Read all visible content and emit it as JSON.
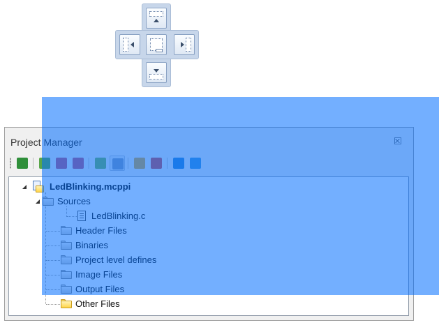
{
  "panel": {
    "title": "Project Manager"
  },
  "toolbar": {
    "buttons": [
      {
        "icon": "open-project-icon",
        "color": "#2f8f3a"
      },
      {
        "icon": "build-project-icon",
        "color": "#5aa64a"
      },
      {
        "icon": "build-all-icon",
        "color": "#c0597a"
      },
      {
        "icon": "build-debug-icon",
        "color": "#c0597a"
      },
      {
        "icon": "add-file-icon",
        "color": "#7ab65a"
      },
      {
        "icon": "remove-file-icon",
        "color": "#8d9db8"
      },
      {
        "icon": "add-folder-icon",
        "color": "#e0a83a"
      },
      {
        "icon": "remove-folder-icon",
        "color": "#d05050"
      },
      {
        "icon": "edit-project-icon",
        "color": "#3a8ad0"
      },
      {
        "icon": "clean-project-icon",
        "color": "#4a9ad8"
      }
    ]
  },
  "tree": {
    "root": "LedBlinking.mcppi",
    "sources": "Sources",
    "source_file": "LedBlinking.c",
    "folders": [
      "Header Files",
      "Binaries",
      "Project level defines",
      "Image Files",
      "Output Files",
      "Other Files"
    ]
  },
  "colors": {
    "dock_preview": "#006eff",
    "dock_guide": "#c7d6ea",
    "selected_folder": "#ffd54a"
  }
}
